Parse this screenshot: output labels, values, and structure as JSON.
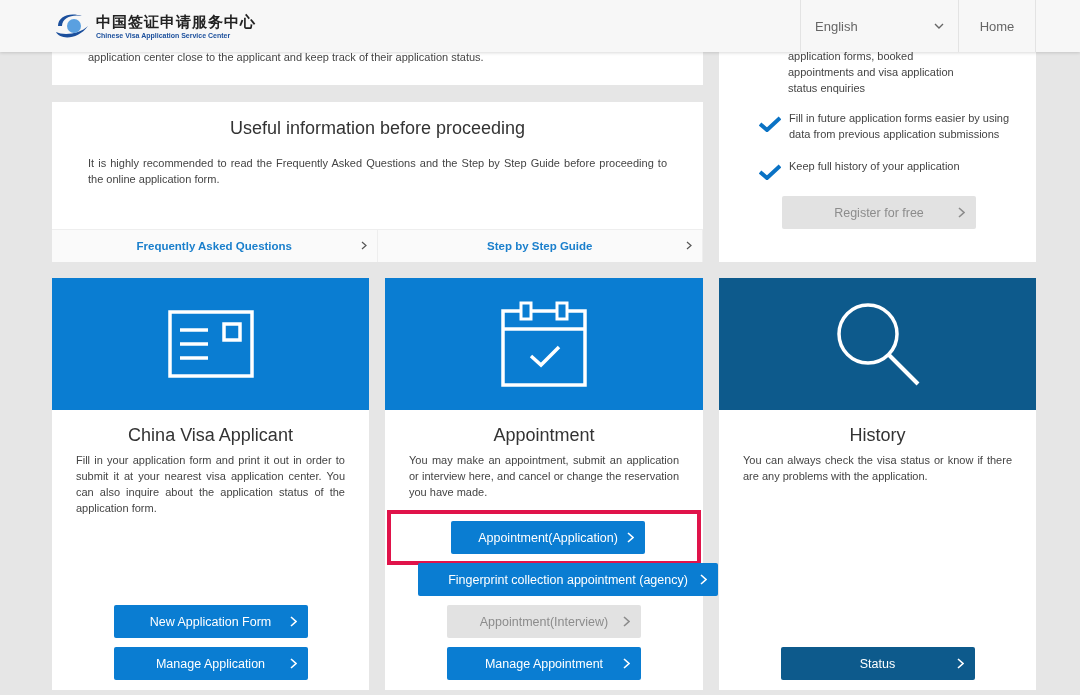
{
  "header": {
    "logo_title": "中国签证申请服务中心",
    "logo_subtitle": "Chinese Visa Application Service Center",
    "language": "English",
    "nav": [
      "Home"
    ]
  },
  "intro_text": "application center close to the applicant and keep track of their application status.",
  "info": {
    "title": "Useful information before proceeding",
    "text": "It is highly recommended to read the Frequently Asked Questions and the Step by Step Guide before proceeding to the online application form.",
    "links": [
      "Frequently Asked Questions",
      "Step by Step Guide"
    ]
  },
  "register": {
    "lead_text": "application forms, booked appointments and visa application status enquiries",
    "benefits": [
      "Fill in future application forms easier by using data from previous application submissions",
      "Keep full history of your application"
    ],
    "button": {
      "label": "Register for free",
      "disabled": true
    }
  },
  "cards": [
    {
      "kind": "applicant",
      "color": "#0a7dd2",
      "title": "China Visa Applicant",
      "text": "Fill in your application form and print it out in order to submit it at your nearest visa application center. You can also inquire about the application status of the application form.",
      "buttons": [
        {
          "label": "New Application Form",
          "disabled": false,
          "highlighted": false,
          "wide": false
        },
        {
          "label": "Manage Application",
          "disabled": false,
          "highlighted": false,
          "wide": false
        }
      ]
    },
    {
      "kind": "appointment",
      "color": "#0a7dd2",
      "title": "Appointment",
      "text": "You may make an appointment, submit an application or interview here, and cancel or change the reservation you have made.",
      "buttons": [
        {
          "label": "Appointment(Application)",
          "disabled": false,
          "highlighted": true,
          "wide": false
        },
        {
          "label": "Fingerprint collection appointment (agency)",
          "disabled": false,
          "highlighted": false,
          "wide": true
        },
        {
          "label": "Appointment(Interview)",
          "disabled": true,
          "highlighted": false,
          "wide": false
        },
        {
          "label": "Manage Appointment",
          "disabled": false,
          "highlighted": false,
          "wide": false
        }
      ]
    },
    {
      "kind": "history",
      "color": "#0d5a8c",
      "title": "History",
      "text": "You can always check the visa status or know if there are any problems with the application.",
      "buttons": [
        {
          "label": "Status",
          "disabled": false,
          "highlighted": false,
          "wide": false
        }
      ]
    }
  ]
}
